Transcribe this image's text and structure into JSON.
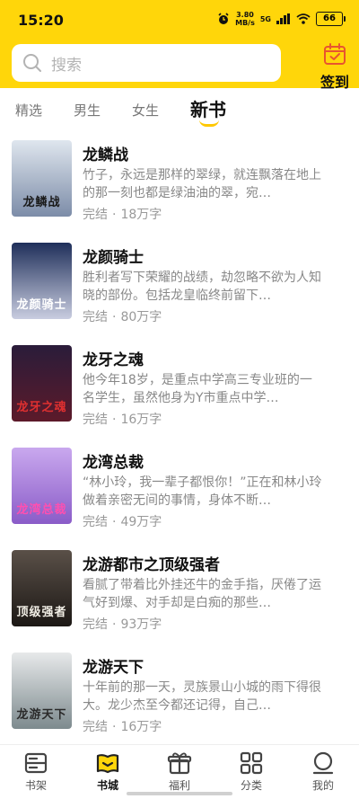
{
  "status_bar": {
    "time": "15:20",
    "net_speed_value": "3.80",
    "net_speed_unit": "MB/s",
    "network_type": "5G",
    "battery": "66"
  },
  "search": {
    "placeholder": "搜索"
  },
  "signin": {
    "label": "签到"
  },
  "tabs": [
    {
      "label": "精选",
      "active": false
    },
    {
      "label": "男生",
      "active": false
    },
    {
      "label": "女生",
      "active": false
    },
    {
      "label": "新书",
      "active": true
    }
  ],
  "books": [
    {
      "title": "龙鳞战",
      "desc": "竹子，永远是那样的翠绿，就连飘落在地上的那一刻也都是绿油油的翠，宛…",
      "status": "完结",
      "words": "18万字",
      "cover_text": "龙鳞战",
      "cover_top": "#dfe6ee",
      "cover_bottom": "#7c8ca8",
      "cover_text_color": "#1a1a1a"
    },
    {
      "title": "龙颜骑士",
      "desc": "胜利者写下荣耀的战绩，劫忽略不欲为人知晓的部份。包括龙皇临终前留下…",
      "status": "完结",
      "words": "80万字",
      "cover_text": "龙颜骑士",
      "cover_top": "#1f2f5a",
      "cover_bottom": "#c9cde0",
      "cover_text_color": "#ffffff"
    },
    {
      "title": "龙牙之魂",
      "desc": "他今年18岁，是重点中学高三专业班的一名学生，虽然他身为Y市重点中学…",
      "status": "完结",
      "words": "16万字",
      "cover_text": "龙牙之魂",
      "cover_top": "#2a1c3a",
      "cover_bottom": "#5c1a2a",
      "cover_text_color": "#e03030"
    },
    {
      "title": "龙湾总裁",
      "desc": "“林小玲，我一辈子都恨你！”正在和林小玲做着亲密无间的事情，身体不断…",
      "status": "完结",
      "words": "49万字",
      "cover_text": "龙湾总裁",
      "cover_top": "#c9a8ee",
      "cover_bottom": "#8a5cc8",
      "cover_text_color": "#ff4fb0"
    },
    {
      "title": "龙游都市之顶级强者",
      "desc": "看腻了带着比外挂还牛的金手指，厌倦了运气好到爆、对手却是白痴的那些…",
      "status": "完结",
      "words": "93万字",
      "cover_text": "顶级强者",
      "cover_top": "#5a5048",
      "cover_bottom": "#1c1815",
      "cover_text_color": "#f2efe6"
    },
    {
      "title": "龙游天下",
      "desc": "十年前的那一天，灵族景山小城的雨下得很大。龙少杰至今都还记得，自己…",
      "status": "完结",
      "words": "16万字",
      "cover_text": "龙游天下",
      "cover_top": "#e7e9ea",
      "cover_bottom": "#7d8a8e",
      "cover_text_color": "#2a2a2a"
    }
  ],
  "meta_separator": "·",
  "bottom_nav": [
    {
      "label": "书架",
      "icon": "bookshelf-icon",
      "active": false
    },
    {
      "label": "书城",
      "icon": "bookstore-icon",
      "active": true
    },
    {
      "label": "福利",
      "icon": "gift-icon",
      "active": false
    },
    {
      "label": "分类",
      "icon": "category-icon",
      "active": false
    },
    {
      "label": "我的",
      "icon": "profile-icon",
      "active": false
    }
  ],
  "colors": {
    "brand_yellow": "#ffd60a",
    "accent": "#ffc800",
    "indicator": "#ffc800"
  }
}
